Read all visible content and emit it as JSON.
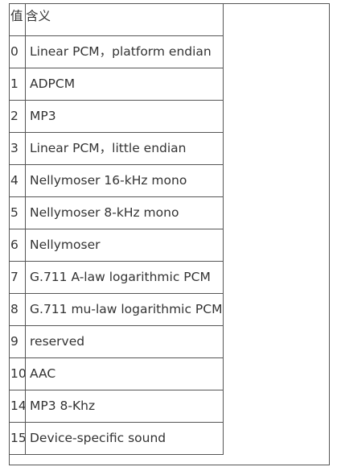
{
  "table": {
    "headers": {
      "value": "值",
      "meaning": "含义"
    },
    "rows": [
      {
        "value": "0",
        "meaning": "Linear PCM，platform endian"
      },
      {
        "value": "1",
        "meaning": "ADPCM"
      },
      {
        "value": "2",
        "meaning": "MP3"
      },
      {
        "value": "3",
        "meaning": "Linear PCM，little endian"
      },
      {
        "value": "4",
        "meaning": "Nellymoser 16-kHz mono"
      },
      {
        "value": "5",
        "meaning": "Nellymoser 8-kHz mono"
      },
      {
        "value": "6",
        "meaning": "Nellymoser"
      },
      {
        "value": "7",
        "meaning": "G.711 A-law logarithmic PCM"
      },
      {
        "value": "8",
        "meaning": "G.711 mu-law logarithmic PCM"
      },
      {
        "value": "9",
        "meaning": "reserved"
      },
      {
        "value": "10",
        "meaning": "AAC"
      },
      {
        "value": "14",
        "meaning": "MP3 8-Khz"
      },
      {
        "value": "15",
        "meaning": "Device-specific sound"
      }
    ]
  }
}
